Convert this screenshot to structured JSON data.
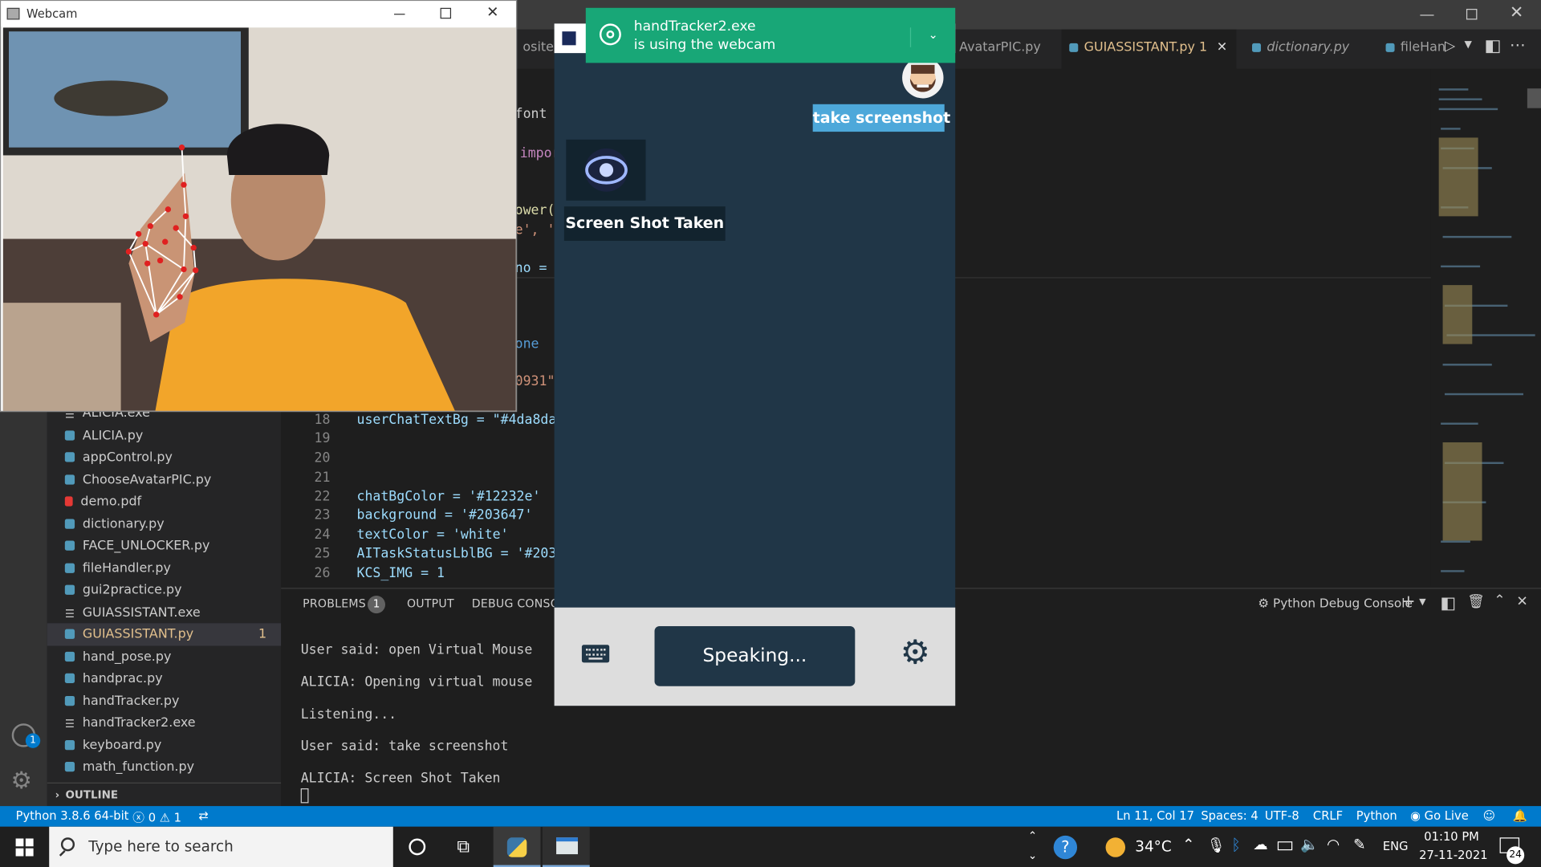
{
  "editor_tabs": [
    {
      "label": "osites.j"
    },
    {
      "label": "AvatarPIC.py"
    },
    {
      "label": "GUIASSISTANT.py 1"
    },
    {
      "label": "dictionary.py"
    },
    {
      "label": "fileHan"
    }
  ],
  "editor": {
    "fragments": [
      "font",
      "impor",
      "ower()",
      "e', 'f",
      "no = '",
      "one",
      "0931\""
    ],
    "lines": [
      {
        "n": "18",
        "code": "userChatTextBg = \"#4da8da\""
      },
      {
        "n": "19",
        "code": ""
      },
      {
        "n": "20",
        "code": ""
      },
      {
        "n": "21",
        "code": ""
      },
      {
        "n": "22",
        "code": "chatBgColor = '#12232e'"
      },
      {
        "n": "23",
        "code": "background = '#203647'"
      },
      {
        "n": "24",
        "code": "textColor = 'white'"
      },
      {
        "n": "25",
        "code": "AITaskStatusLblBG = '#203("
      },
      {
        "n": "26",
        "code": "KCS_IMG = 1"
      }
    ]
  },
  "explorer": {
    "files": [
      {
        "name": "ALICIA.exe",
        "type": "exe"
      },
      {
        "name": "ALICIA.py",
        "type": "py"
      },
      {
        "name": "appControl.py",
        "type": "py"
      },
      {
        "name": "ChooseAvatarPIC.py",
        "type": "py"
      },
      {
        "name": "demo.pdf",
        "type": "pdf"
      },
      {
        "name": "dictionary.py",
        "type": "py"
      },
      {
        "name": "FACE_UNLOCKER.py",
        "type": "py"
      },
      {
        "name": "fileHandler.py",
        "type": "py"
      },
      {
        "name": "gui2practice.py",
        "type": "py"
      },
      {
        "name": "GUIASSISTANT.exe",
        "type": "exe"
      },
      {
        "name": "GUIASSISTANT.py",
        "type": "py",
        "badge": "1"
      },
      {
        "name": "hand_pose.py",
        "type": "py"
      },
      {
        "name": "handprac.py",
        "type": "py"
      },
      {
        "name": "handTracker.py",
        "type": "py"
      },
      {
        "name": "handTracker2.exe",
        "type": "exe"
      },
      {
        "name": "keyboard.py",
        "type": "py"
      },
      {
        "name": "math_function.py",
        "type": "py"
      }
    ],
    "outline_label": "OUTLINE"
  },
  "activity": {
    "accounts_badge": "1"
  },
  "panel": {
    "tabs": [
      "PROBLEMS",
      "OUTPUT",
      "DEBUG CONSOL"
    ],
    "problems_count": "1",
    "console_label": "Python Debug Console",
    "lines": [
      "User said: open Virtual Mouse",
      "ALICIA: Opening virtual mouse",
      "Listening...",
      "User said: take screenshot",
      "ALICIA: Screen Shot Taken"
    ]
  },
  "statusbar": {
    "interpreter": "Python 3.8.6 64-bit",
    "errors": "0",
    "warnings": "1",
    "position": "Ln 11, Col 17",
    "spaces": "Spaces: 4",
    "encoding": "UTF-8",
    "eol": "CRLF",
    "language": "Python",
    "golive": "Go Live"
  },
  "webcam": {
    "title": "Webcam"
  },
  "toast": {
    "line1": "handTracker2.exe",
    "line2": "is using the webcam"
  },
  "assistant": {
    "user_message": "take screenshot",
    "ai_message": "Screen Shot Taken",
    "status": "Speaking...",
    "colors": {
      "background": "#203647",
      "user_bubble": "#4da8da",
      "ai_bubble": "#12232e"
    }
  },
  "taskbar": {
    "search_placeholder": "Type here to search",
    "temperature": "34°C",
    "language": "ENG",
    "time": "01:10 PM",
    "date": "27-11-2021",
    "notification_count": "24"
  }
}
